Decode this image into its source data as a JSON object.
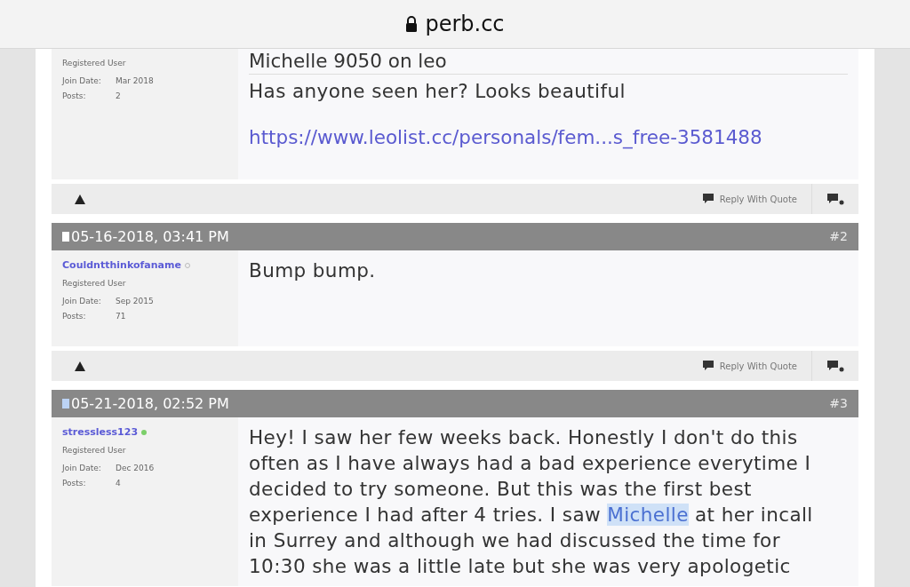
{
  "address_bar": {
    "domain": "perb.cc"
  },
  "posts": [
    {
      "user": {
        "role": "Registered User",
        "join_label": "Join Date:",
        "join_date": "Mar 2018",
        "posts_label": "Posts:",
        "posts": "2"
      },
      "title": "Michelle 9050 on leo",
      "message": [
        [
          {
            "text": "Has anyone seen her? Looks beautiful",
            "highlighted": false
          }
        ]
      ],
      "link": "https://www.leolist.cc/personals/fem...s_free-3581488",
      "footer": {
        "reply": "Reply With Quote"
      }
    },
    {
      "header": {
        "date": "05-16-2018, 03:41 PM",
        "number": "#2",
        "new": false
      },
      "user": {
        "name": "Couldntthinkofaname",
        "online": false,
        "role": "Registered User",
        "join_label": "Join Date:",
        "join_date": "Sep 2015",
        "posts_label": "Posts:",
        "posts": "71"
      },
      "message": [
        [
          {
            "text": "Bump bump.",
            "highlighted": false
          }
        ]
      ],
      "footer": {
        "reply": "Reply With Quote"
      }
    },
    {
      "header": {
        "date": "05-21-2018, 02:52 PM",
        "number": "#3",
        "new": true
      },
      "user": {
        "name": "stressless123",
        "online": true,
        "role": "Registered User",
        "join_label": "Join Date:",
        "join_date": "Dec 2016",
        "posts_label": "Posts:",
        "posts": "4"
      },
      "message": [
        [
          {
            "text": "Hey! I saw her few weeks back. Honestly I don't do this",
            "highlighted": false
          }
        ],
        [
          {
            "text": "often as I have always had a bad experience everytime I",
            "highlighted": false
          }
        ],
        [
          {
            "text": "decided to try someone. But this was the first best",
            "highlighted": false
          }
        ],
        [
          {
            "text": "experience I had after 4 tries. I saw ",
            "highlighted": false
          },
          {
            "text": "Michelle",
            "highlighted": true
          },
          {
            "text": " at her incall",
            "highlighted": false
          }
        ],
        [
          {
            "text": "in Surrey and although we had discussed the time for",
            "highlighted": false
          }
        ],
        [
          {
            "text": "10:30 she was a little late but she was very apologetic",
            "highlighted": false
          }
        ]
      ]
    }
  ]
}
